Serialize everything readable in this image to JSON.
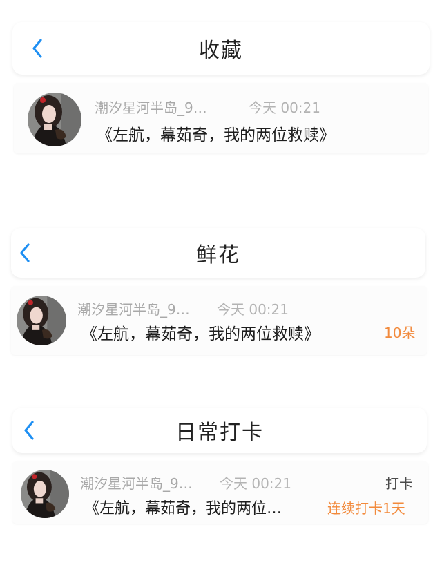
{
  "colors": {
    "accent": "#1e8ff3",
    "orange": "#f28a3c"
  },
  "sections": [
    {
      "title": "收藏",
      "item": {
        "name": "潮汐星河半岛_9…",
        "time": "今天 00:21",
        "message": "《左航，幕茹奇，我的两位救赎》"
      }
    },
    {
      "title": "鲜花",
      "item": {
        "name": "潮汐星河半岛_9…",
        "time": "今天 00:21",
        "message": "《左航，幕茹奇，我的两位救赎》",
        "badge": "10朵"
      }
    },
    {
      "title": "日常打卡",
      "item": {
        "name": "潮汐星河半岛_9…",
        "time": "今天 00:21",
        "message": "《左航，幕茹奇，我的两位…",
        "tag": "打卡",
        "badge": "连续打卡1天"
      }
    }
  ]
}
